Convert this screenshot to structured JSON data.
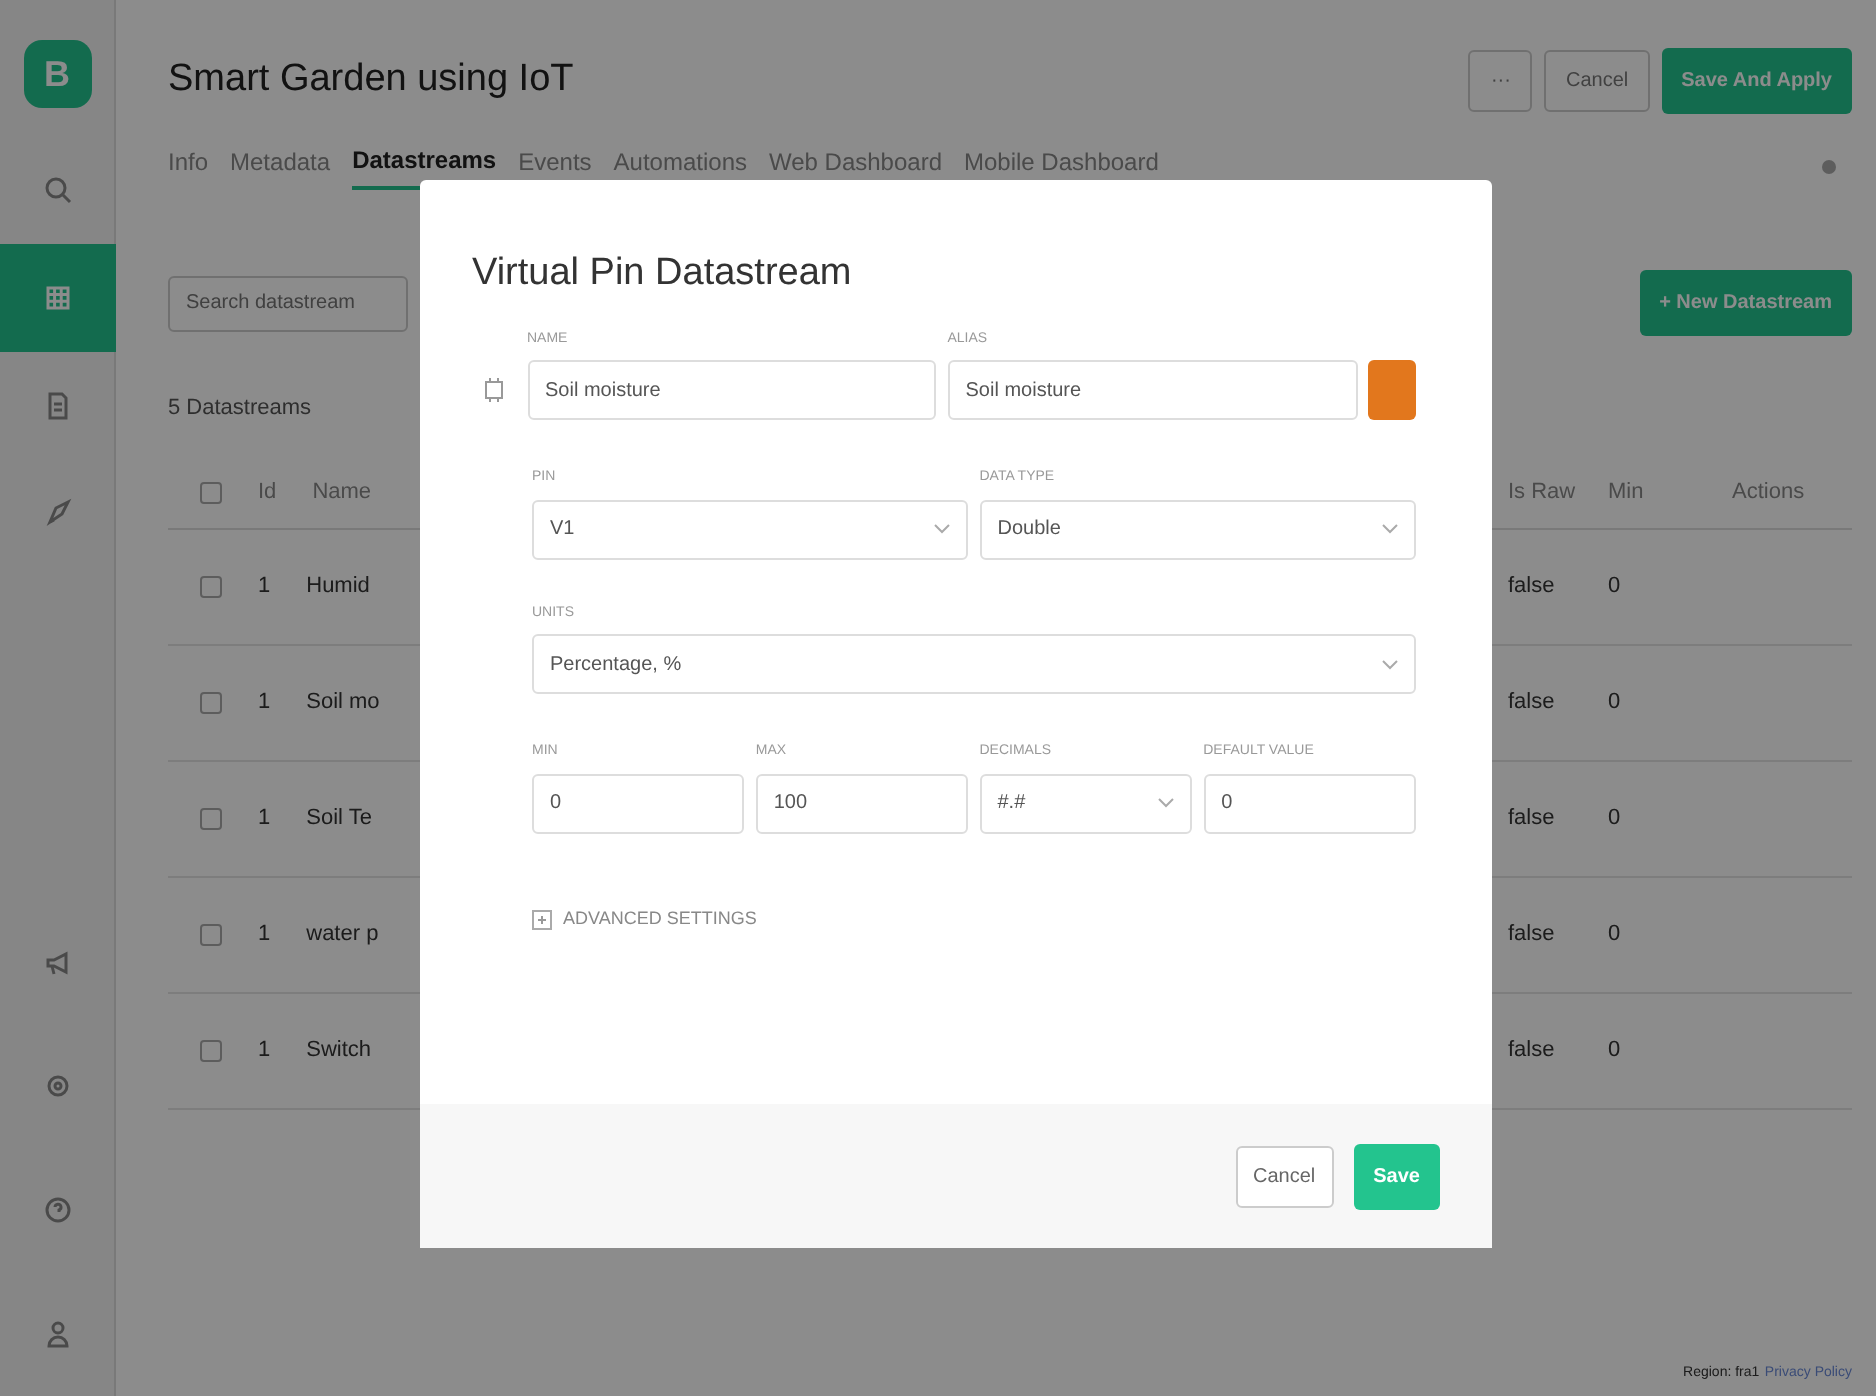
{
  "sidebar": {
    "logo": "B",
    "items": [
      {
        "selected": false
      },
      {
        "selected": true
      },
      {
        "selected": false
      },
      {
        "selected": false
      }
    ]
  },
  "header": {
    "title": "Smart Garden using IoT",
    "more": "···",
    "cancel": "Cancel",
    "save": "Save And Apply"
  },
  "tabs": [
    {
      "label": "Info",
      "selected": false
    },
    {
      "label": "Metadata",
      "selected": false
    },
    {
      "label": "Datastreams",
      "selected": true
    },
    {
      "label": "Events",
      "selected": false
    },
    {
      "label": "Automations",
      "selected": false
    },
    {
      "label": "Web Dashboard",
      "selected": false
    },
    {
      "label": "Mobile Dashboard",
      "selected": false
    }
  ],
  "search": {
    "placeholder": "Search datastream"
  },
  "new_button": "+ New Datastream",
  "count": "5 Datastreams",
  "table": {
    "select_all_checked": false,
    "columns_left": [
      "Id",
      "Name"
    ],
    "columns_right": [
      "Is Raw",
      "Min",
      "Actions"
    ],
    "rows": [
      {
        "checked": false,
        "id": "1",
        "name": "Humid",
        "raw": "false",
        "min": "0"
      },
      {
        "checked": false,
        "id": "1",
        "name": "Soil mo",
        "raw": "false",
        "min": "0"
      },
      {
        "checked": false,
        "id": "1",
        "name": "Soil Te",
        "raw": "false",
        "min": "0"
      },
      {
        "checked": false,
        "id": "1",
        "name": "water p",
        "raw": "false",
        "min": "0"
      },
      {
        "checked": false,
        "id": "1",
        "name": "Switch",
        "raw": "false",
        "min": "0"
      }
    ]
  },
  "footer": {
    "region": "Region: fra1",
    "link": "Privacy Policy"
  },
  "modal": {
    "title": "Virtual Pin Datastream",
    "name": {
      "label": "NAME",
      "value": "Soil moisture"
    },
    "alias": {
      "label": "ALIAS",
      "value": "Soil moisture",
      "color": "#e2771d"
    },
    "pin": {
      "label": "PIN",
      "value": "V1"
    },
    "data_type": {
      "label": "DATA TYPE",
      "value": "Double"
    },
    "units": {
      "label": "UNITS",
      "value": "Percentage, %"
    },
    "limits": [
      {
        "label": "MIN",
        "value": "0",
        "kind": "input"
      },
      {
        "label": "MAX",
        "value": "100",
        "kind": "input"
      },
      {
        "label": "DECIMALS",
        "value": "#.#",
        "kind": "select"
      },
      {
        "label": "DEFAULT VALUE",
        "value": "0",
        "kind": "input"
      }
    ],
    "advanced": {
      "label": "ADVANCED SETTINGS",
      "expanded": false
    },
    "cancel": "Cancel",
    "save": "Save"
  }
}
